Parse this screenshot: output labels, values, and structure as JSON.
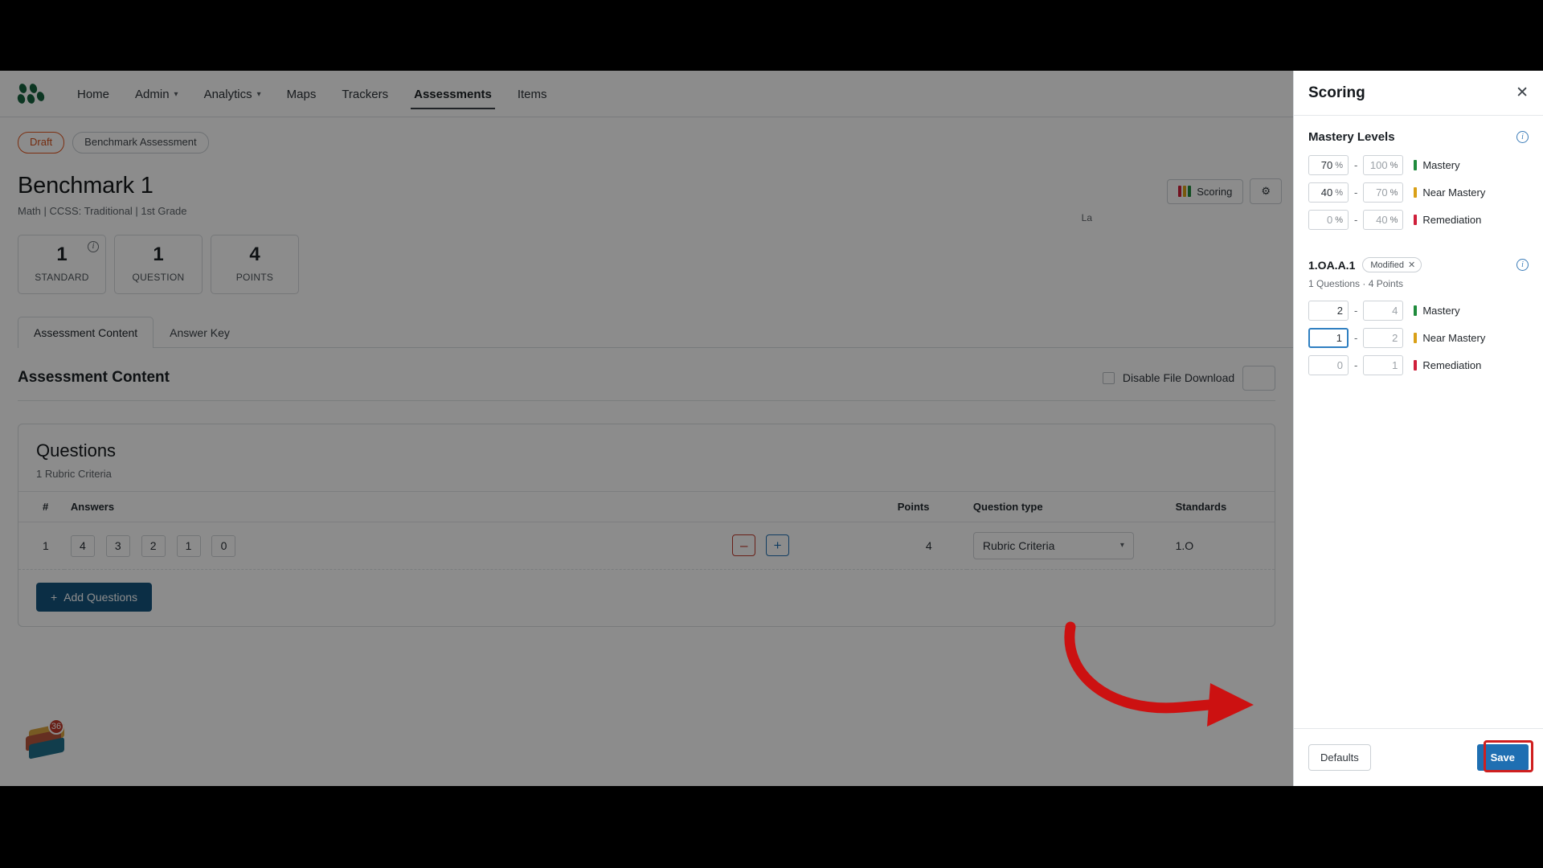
{
  "nav": {
    "logo_icon": "otus-dots-logo",
    "items": [
      {
        "label": "Home",
        "has_caret": false,
        "active": false
      },
      {
        "label": "Admin",
        "has_caret": true,
        "active": false
      },
      {
        "label": "Analytics",
        "has_caret": true,
        "active": false
      },
      {
        "label": "Maps",
        "has_caret": false,
        "active": false
      },
      {
        "label": "Trackers",
        "has_caret": false,
        "active": false
      },
      {
        "label": "Assessments",
        "has_caret": false,
        "active": true
      },
      {
        "label": "Items",
        "has_caret": false,
        "active": false
      }
    ]
  },
  "page": {
    "status_pill": "Draft",
    "type_pill": "Benchmark Assessment",
    "title": "Benchmark 1",
    "subtitle": "Math  |  CCSS: Traditional  |  1st Grade",
    "last_saved": "La",
    "stats": [
      {
        "value": "1",
        "label": "STANDARD",
        "has_info": true
      },
      {
        "value": "1",
        "label": "QUESTION",
        "has_info": false
      },
      {
        "value": "4",
        "label": "POINTS",
        "has_info": false
      }
    ],
    "toolbar": {
      "scoring_label": "Scoring",
      "gear_icon": "gear-icon"
    },
    "tabs": [
      {
        "label": "Assessment Content",
        "active": true
      },
      {
        "label": "Answer Key",
        "active": false
      }
    ],
    "section_title": "Assessment Content",
    "disable_download_label": "Disable File Download"
  },
  "questions_card": {
    "title": "Questions",
    "subtitle": "1 Rubric Criteria",
    "columns": [
      "#",
      "Answers",
      "Points",
      "Question type",
      "Standards"
    ],
    "rows": [
      {
        "num": "1",
        "answers": [
          "4",
          "3",
          "2",
          "1",
          "0"
        ],
        "minus_label": "–",
        "plus_label": "+",
        "points": "4",
        "question_type": "Rubric Criteria",
        "standard": "1.O"
      }
    ],
    "add_questions_label": "Add Questions",
    "add_questions_icon": "plus-icon"
  },
  "stack_widget": {
    "badge_count": "36"
  },
  "drawer": {
    "title": "Scoring",
    "close_icon": "close-icon",
    "mastery_levels": {
      "heading": "Mastery Levels",
      "info_icon": "info-icon",
      "rows": [
        {
          "from": "70",
          "from_unit": "%",
          "to": "100",
          "to_unit": "%",
          "name": "Mastery",
          "color": "#1f8b3c",
          "from_dim": false,
          "to_dim": true,
          "focused": false
        },
        {
          "from": "40",
          "from_unit": "%",
          "to": "70",
          "to_unit": "%",
          "name": "Near Mastery",
          "color": "#d9a017",
          "from_dim": false,
          "to_dim": true,
          "focused": false
        },
        {
          "from": "0",
          "from_unit": "%",
          "to": "40",
          "to_unit": "%",
          "name": "Remediation",
          "color": "#cf1f3a",
          "from_dim": true,
          "to_dim": true,
          "focused": false
        }
      ]
    },
    "standard": {
      "code": "1.OA.A.1",
      "tag": "Modified",
      "tag_close_icon": "close-small-icon",
      "info_icon": "info-icon",
      "summary": "1 Questions · 4 Points",
      "rows": [
        {
          "from": "2",
          "from_unit": "",
          "to": "4",
          "to_unit": "",
          "name": "Mastery",
          "color": "#1f8b3c",
          "from_dim": false,
          "to_dim": true,
          "focused": false
        },
        {
          "from": "1",
          "from_unit": "",
          "to": "2",
          "to_unit": "",
          "name": "Near Mastery",
          "color": "#d9a017",
          "from_dim": false,
          "to_dim": true,
          "focused": true
        },
        {
          "from": "0",
          "from_unit": "",
          "to": "1",
          "to_unit": "",
          "name": "Remediation",
          "color": "#cf1f3a",
          "from_dim": true,
          "to_dim": true,
          "focused": false
        }
      ]
    },
    "footer": {
      "defaults_label": "Defaults",
      "save_label": "Save"
    }
  },
  "annotation": {
    "arrow_color": "#cc1111",
    "highlight_color": "#cf1f1f"
  }
}
